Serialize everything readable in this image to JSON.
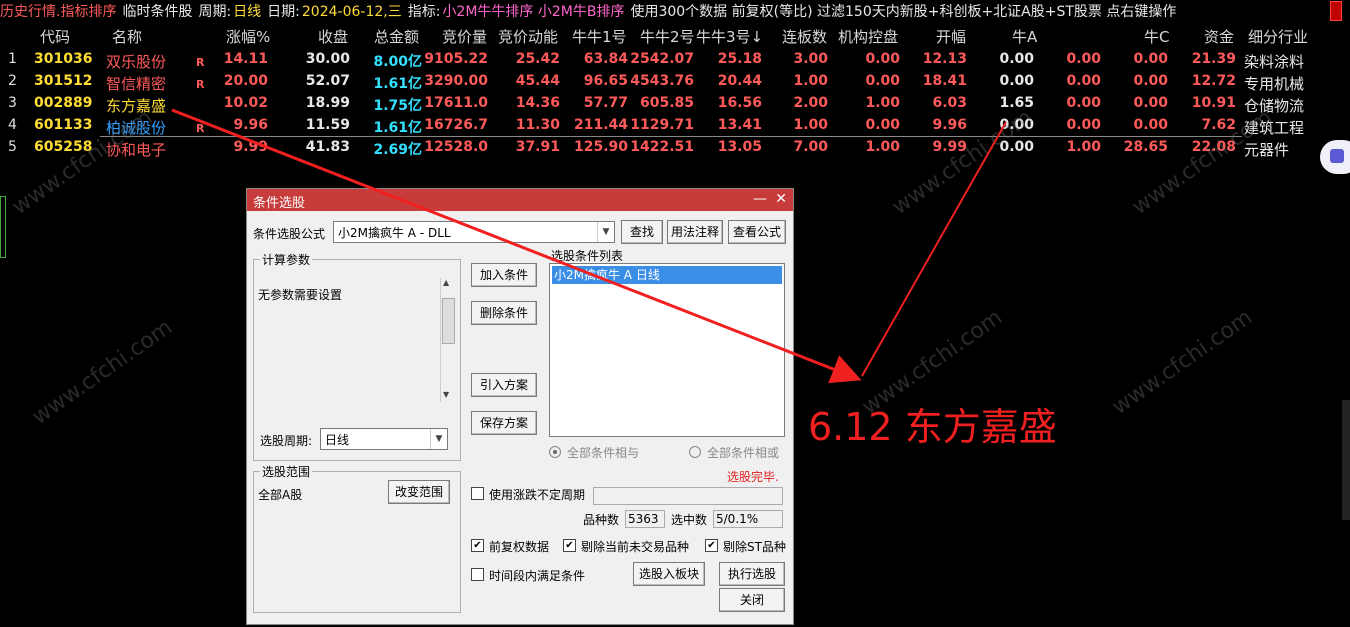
{
  "topbar": {
    "section": "历史行情.指标排序",
    "mode": "临时条件股",
    "period_label": "周期:",
    "period_value": "日线",
    "date_label": "日期:",
    "date_value": "2024-06-12,三",
    "indicator_label": "指标:",
    "indicator_value": "小2M牛牛排序 小2M牛B排序",
    "info": "使用300个数据 前复权(等比) 过滤150天内新股+科创板+北证A股+ST股票 点右键操作"
  },
  "table": {
    "columns": [
      "代码",
      "名称",
      "涨幅%",
      "收盘",
      "总金额",
      "竞价量",
      "竞价动能",
      "牛牛1号",
      "牛牛2号",
      "牛牛3号↓",
      "连板数",
      "机构控盘",
      "开幅",
      "牛A",
      "",
      "牛C",
      "资金",
      "细分行业"
    ],
    "rows": [
      {
        "idx": "1",
        "code": "301036",
        "name": "双乐股份",
        "name_color": "#ff5a5a",
        "flag": "R",
        "pct": "14.11",
        "close": "30.00",
        "amount": "8.00亿",
        "bid_vol": "9105.22",
        "bid_power": "25.42",
        "n1": "63.84",
        "n2": "2542.07",
        "n3": "25.18",
        "lianban": "3.00",
        "jigou": "0.00",
        "kaifu": "12.13",
        "niuA": "0.00",
        "niuB": "0.00",
        "niuC": "0.00",
        "zijin": "21.39",
        "industry": "染料涂料"
      },
      {
        "idx": "2",
        "code": "301512",
        "name": "智信精密",
        "name_color": "#ff5a5a",
        "flag": "R",
        "pct": "20.00",
        "close": "52.07",
        "amount": "1.61亿",
        "bid_vol": "3290.00",
        "bid_power": "45.44",
        "n1": "96.65",
        "n2": "4543.76",
        "n3": "20.44",
        "lianban": "1.00",
        "jigou": "0.00",
        "kaifu": "18.41",
        "niuA": "0.00",
        "niuB": "0.00",
        "niuC": "0.00",
        "zijin": "12.72",
        "industry": "专用机械"
      },
      {
        "idx": "3",
        "code": "002889",
        "name": "东方嘉盛",
        "name_color": "#ffdd33",
        "flag": "",
        "pct": "10.02",
        "close": "18.99",
        "amount": "1.75亿",
        "bid_vol": "17611.0",
        "bid_power": "14.36",
        "n1": "57.77",
        "n2": "605.85",
        "n3": "16.56",
        "lianban": "2.00",
        "jigou": "1.00",
        "kaifu": "6.03",
        "niuA": "1.65",
        "niuB": "0.00",
        "niuC": "0.00",
        "zijin": "10.91",
        "industry": "仓储物流"
      },
      {
        "idx": "4",
        "code": "601133",
        "name": "柏诚股份",
        "name_color": "#33a0ff",
        "flag": "R",
        "pct": "9.96",
        "close": "11.59",
        "amount": "1.61亿",
        "bid_vol": "16726.7",
        "bid_power": "11.30",
        "n1": "211.44",
        "n2": "1129.71",
        "n3": "13.41",
        "lianban": "1.00",
        "jigou": "0.00",
        "kaifu": "9.96",
        "niuA": "0.00",
        "niuB": "0.00",
        "niuC": "0.00",
        "zijin": "7.62",
        "industry": "建筑工程"
      },
      {
        "idx": "5",
        "code": "605258",
        "name": "协和电子",
        "name_color": "#ff5a5a",
        "flag": "",
        "pct": "9.99",
        "close": "41.83",
        "amount": "2.69亿",
        "bid_vol": "12528.0",
        "bid_power": "37.91",
        "n1": "125.90",
        "n2": "1422.51",
        "n3": "13.05",
        "lianban": "7.00",
        "jigou": "1.00",
        "kaifu": "9.99",
        "niuA": "0.00",
        "niuB": "1.00",
        "niuC": "28.65",
        "zijin": "22.08",
        "industry": "元器件"
      }
    ]
  },
  "watermark": "www.cfchi.com",
  "annotation": "6.12 东方嘉盛",
  "dialog": {
    "title": "条件选股",
    "formula_label": "条件选股公式",
    "formula_value": "小2M擒疯牛 A  -  DLL",
    "btn_find": "查找",
    "btn_usage": "用法注释",
    "btn_view": "查看公式",
    "params_group": "计算参数",
    "params_text": "无参数需要设置",
    "period_label": "选股周期:",
    "period_value": "日线",
    "btn_add": "加入条件",
    "btn_delete": "删除条件",
    "btn_import": "引入方案",
    "btn_save": "保存方案",
    "list_title": "选股条件列表",
    "list_item": "小2M擒疯牛 A  日线",
    "radio_and": "全部条件相与",
    "radio_or": "全部条件相或",
    "status": "选股完毕.",
    "range_group": "选股范围",
    "range_value": "全部A股",
    "btn_range": "改变范围",
    "chk_uncertain": "使用涨跌不定周期",
    "count_label": "品种数",
    "count_value": "5363",
    "selected_label": "选中数",
    "selected_value": "5/0.1%",
    "chk_fq": "前复权数据",
    "chk_exclude_untraded": "剔除当前未交易品种",
    "chk_exclude_st": "剔除ST品种",
    "chk_period": "时间段内满足条件",
    "btn_to_block": "选股入板块",
    "btn_execute": "执行选股",
    "btn_close": "关闭"
  }
}
